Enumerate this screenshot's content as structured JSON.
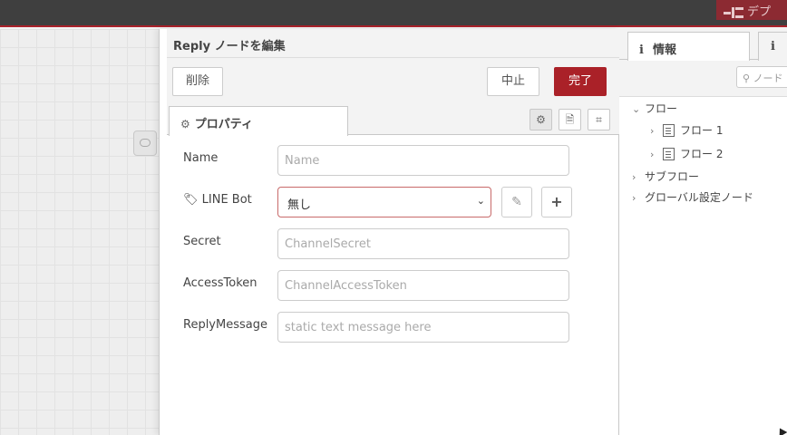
{
  "header": {
    "deploy_label": "デプ"
  },
  "editor": {
    "title": "Reply ノードを編集",
    "delete_label": "削除",
    "cancel_label": "中止",
    "done_label": "完了",
    "tab_properties": "プロパティ",
    "fields": {
      "name_label": "Name",
      "name_placeholder": "Name",
      "linebot_label": "LINE Bot",
      "linebot_value": "無し",
      "secret_label": "Secret",
      "secret_placeholder": "ChannelSecret",
      "token_label": "AccessToken",
      "token_placeholder": "ChannelAccessToken",
      "message_label": "ReplyMessage",
      "message_placeholder": "static text message here"
    }
  },
  "sidebar": {
    "tab_info_icon": "i",
    "tab_info_label": "情報",
    "tab2_icon": "i",
    "search_placeholder": "ノード",
    "tree": {
      "flows_label": "フロー",
      "flow1_label": "フロー 1",
      "flow2_label": "フロー 2",
      "subflows_label": "サブフロー",
      "global_label": "グローバル設定ノード"
    }
  },
  "colors": {
    "accent": "#aa2128",
    "header_bg": "#3f3f3f"
  }
}
